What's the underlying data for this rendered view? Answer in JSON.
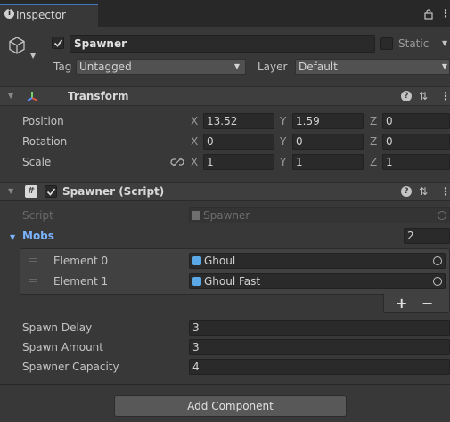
{
  "tab": {
    "title": "Inspector"
  },
  "object": {
    "name": "Spawner",
    "static_label": "Static",
    "tag_label": "Tag",
    "tag_value": "Untagged",
    "layer_label": "Layer",
    "layer_value": "Default"
  },
  "transform": {
    "title": "Transform",
    "position_label": "Position",
    "rotation_label": "Rotation",
    "scale_label": "Scale",
    "axis_x": "X",
    "axis_y": "Y",
    "axis_z": "Z",
    "position": {
      "x": "13.52",
      "y": "1.59",
      "z": "0"
    },
    "rotation": {
      "x": "0",
      "y": "0",
      "z": "0"
    },
    "scale": {
      "x": "1",
      "y": "1",
      "z": "1"
    }
  },
  "spawner": {
    "title": "Spawner (Script)",
    "script_label": "Script",
    "script_value": "Spawner",
    "mobs_label": "Mobs",
    "mobs_count": "2",
    "elements": [
      {
        "label": "Element 0",
        "value": "Ghoul"
      },
      {
        "label": "Element 1",
        "value": "Ghoul Fast"
      }
    ],
    "plus": "+",
    "minus": "−",
    "spawn_delay_label": "Spawn Delay",
    "spawn_delay": "3",
    "spawn_amount_label": "Spawn Amount",
    "spawn_amount": "3",
    "capacity_label": "Spawner Capacity",
    "capacity": "4"
  },
  "add_component": "Add Component",
  "colors": {
    "background": "#383838",
    "header": "#3e3e3e",
    "field": "#2a2a2a",
    "accent_blue": "#7cb3ff"
  }
}
